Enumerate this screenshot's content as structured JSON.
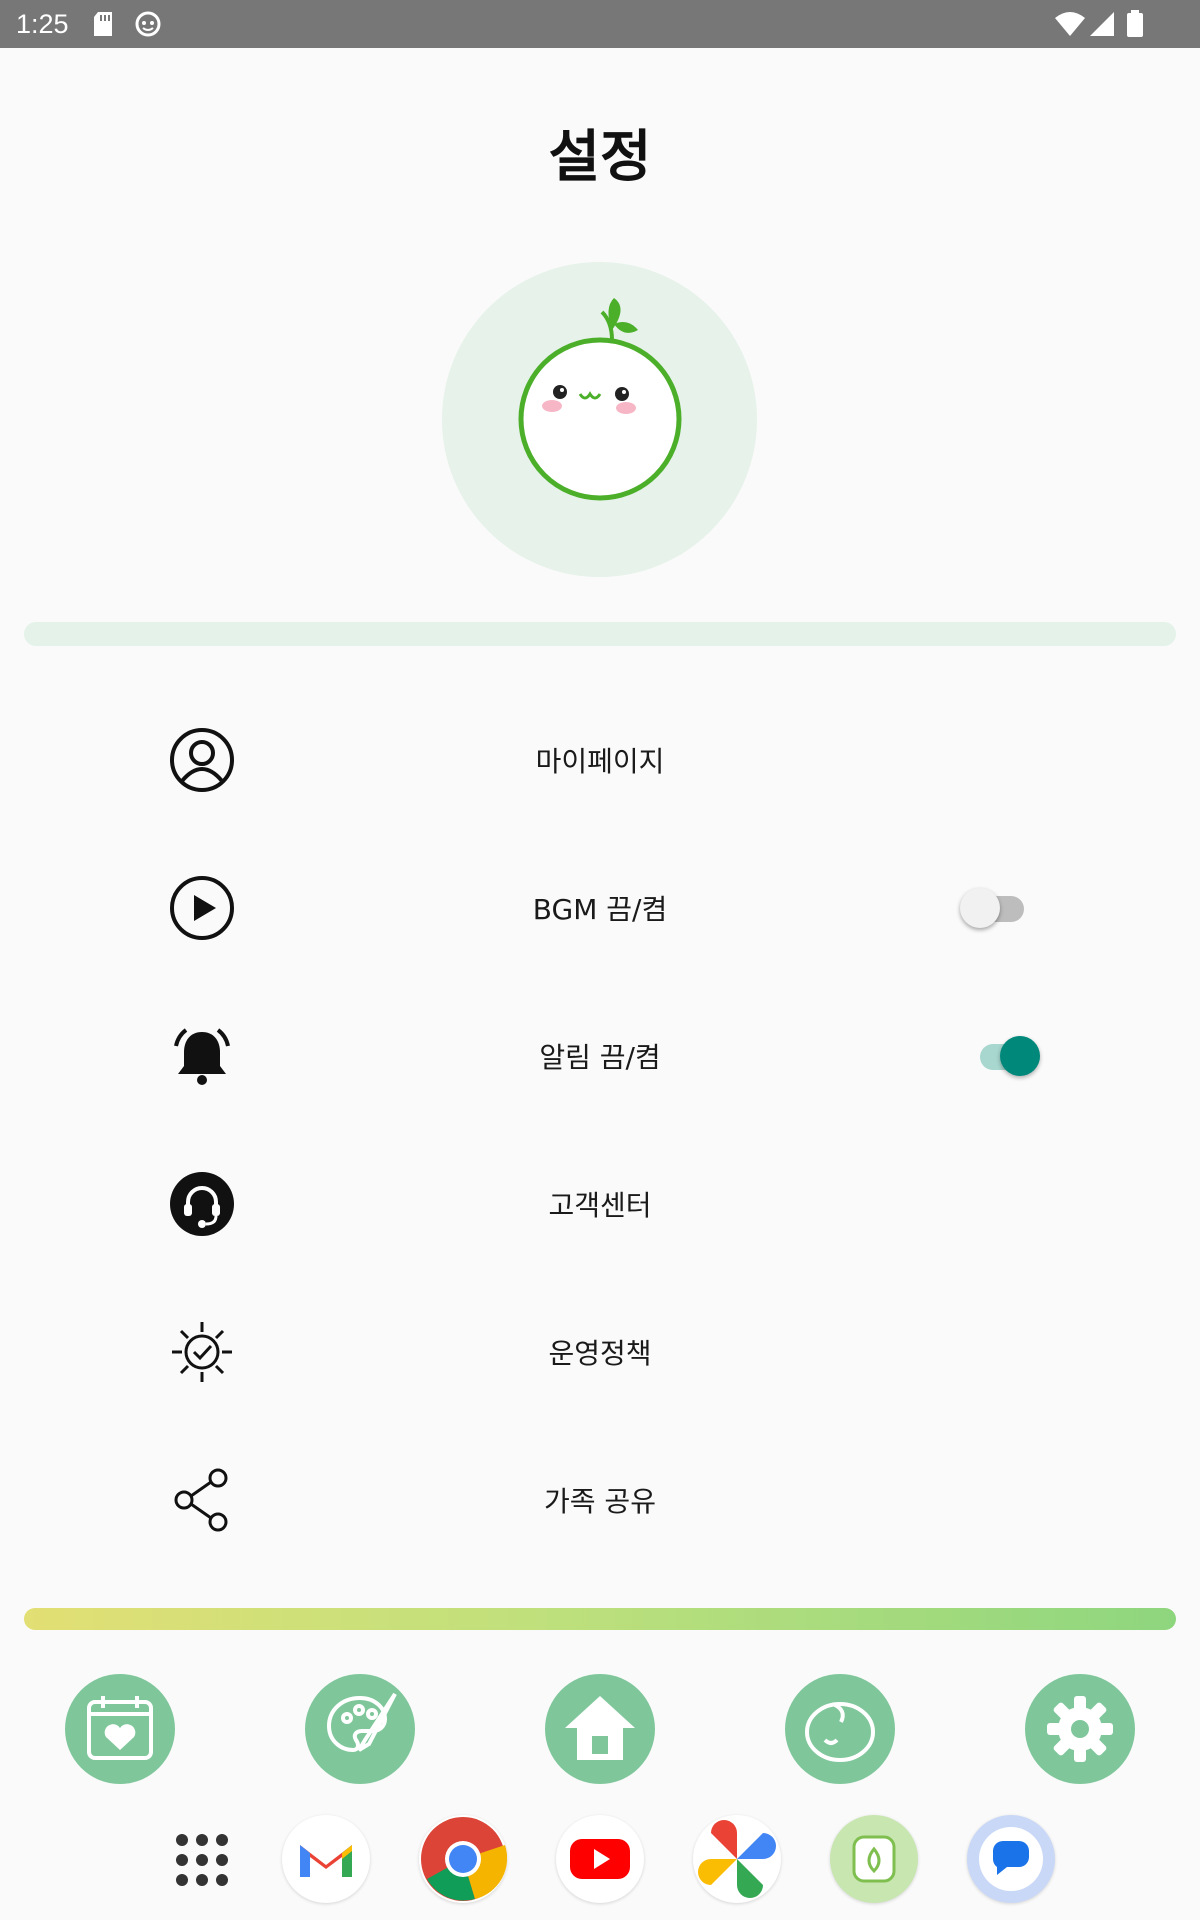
{
  "status_bar": {
    "time": "1:25",
    "icons": [
      "sd-card-icon",
      "app-notification-icon",
      "wifi-icon",
      "signal-icon",
      "battery-icon"
    ]
  },
  "title": "설정",
  "avatar": {
    "icon": "sprout-mascot-icon"
  },
  "menu": [
    {
      "label": "마이페이지",
      "icon": "user-circle-icon"
    },
    {
      "label": "BGM 끔/켬",
      "icon": "play-circle-icon",
      "toggle": false
    },
    {
      "label": "알림 끔/켬",
      "icon": "ringing-bell-icon",
      "toggle": true
    },
    {
      "label": "고객센터",
      "icon": "headset-icon"
    },
    {
      "label": "운영정책",
      "icon": "gear-check-icon"
    },
    {
      "label": "가족 공유",
      "icon": "share-icon"
    }
  ],
  "bottom_nav": [
    "calendar-heart-icon",
    "palette-icon",
    "home-icon",
    "baby-face-icon",
    "settings-gear-icon"
  ],
  "dock": [
    "app-drawer-icon",
    "gmail-icon",
    "chrome-icon",
    "youtube-icon",
    "photos-icon",
    "sprout-app-icon",
    "messages-icon"
  ],
  "colors": {
    "status_bar": "#777777",
    "accent_green": "#7fc79b",
    "toggle_on": "#00897b",
    "avatar_bg": "#e6f2ea"
  }
}
